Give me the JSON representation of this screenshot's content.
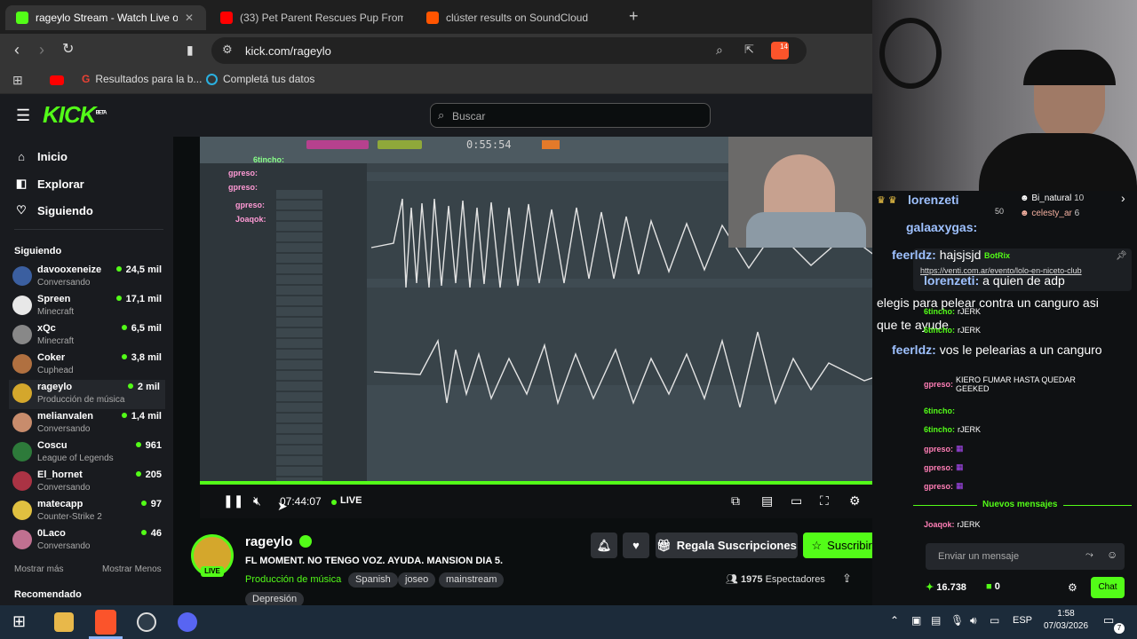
{
  "tabs": [
    {
      "title": "rageylo Stream - Watch Live on Kick",
      "active": true,
      "color": "#53fc18"
    },
    {
      "title": "(33) Pet Parent Rescues Pup From Ka",
      "active": false,
      "color": "#ff0000"
    },
    {
      "title": "clúster results on SoundCloud",
      "active": false,
      "color": "#ff5500"
    }
  ],
  "new_tab_label": "+",
  "address": {
    "url": "kick.com/rageylo",
    "shield_count": "14"
  },
  "bookmarks": [
    {
      "label": "Resultados para la b..."
    },
    {
      "label": "Completá tus datos"
    }
  ],
  "kick": {
    "logo": "KICK",
    "logo_badge": "BETA",
    "search_placeholder": "Buscar",
    "nav": [
      {
        "label": "Inicio",
        "icon": "home-icon"
      },
      {
        "label": "Explorar",
        "icon": "compass-icon"
      },
      {
        "label": "Siguiendo",
        "icon": "heart-icon"
      }
    ],
    "following_title": "Siguiendo",
    "following": [
      {
        "name": "davooxeneize",
        "category": "Conversando",
        "viewers": "24,5 mil",
        "color": "#3b5fa0"
      },
      {
        "name": "Spreen",
        "category": "Minecraft",
        "viewers": "17,1 mil",
        "color": "#e8e8e8"
      },
      {
        "name": "xQc",
        "category": "Minecraft",
        "viewers": "6,5 mil",
        "color": "#888888"
      },
      {
        "name": "Coker",
        "category": "Cuphead",
        "viewers": "3,8 mil",
        "color": "#b07040"
      },
      {
        "name": "rageylo",
        "category": "Producción de música",
        "viewers": "2 mil",
        "color": "#d4a72c"
      },
      {
        "name": "melianvalen",
        "category": "Conversando",
        "viewers": "1,4 mil",
        "color": "#c88c6c"
      },
      {
        "name": "Coscu",
        "category": "League of Legends",
        "viewers": "961",
        "color": "#2d7a3a"
      },
      {
        "name": "El_hornet",
        "category": "Conversando",
        "viewers": "205",
        "color": "#aa3344"
      },
      {
        "name": "matecapp",
        "category": "Counter-Strike 2",
        "viewers": "97",
        "color": "#e0c040"
      },
      {
        "name": "0Laco",
        "category": "Conversando",
        "viewers": "46",
        "color": "#c07090"
      }
    ],
    "show_more": "Mostrar más",
    "show_less": "Mostrar Menos",
    "recommended_title": "Recomendado"
  },
  "player": {
    "daw_time": "0:55:54",
    "elapsed": "07:44:07",
    "live_label": "LIVE",
    "overlay_names": [
      "gpreso:",
      "gpreso:",
      "gpreso:",
      "Joaqok:"
    ],
    "overlay_user": "6tincho:"
  },
  "stream": {
    "channel": "rageylo",
    "title": "FL MOMENT. NO TENGO VOZ. AYUDA. MANSION DIA 5.",
    "category": "Producción de música",
    "tags": [
      "Spanish",
      "joseo",
      "mainstream",
      "Depresión"
    ],
    "live_badge": "LIVE",
    "gift_label": "Regala Suscripciones",
    "subscribe_label": "Suscribirse",
    "viewers": "1975",
    "viewers_label": "Espectadores"
  },
  "chat": {
    "top_user_1": {
      "name": "Bi_natural",
      "count": "10"
    },
    "top_user_2": {
      "name": "celesty_ar",
      "count": "6"
    },
    "top_user_3_count": "50",
    "pinned_user": "BotRix",
    "pinned_link": "https://venti.com.ar/evento/lolo-en-niceto-club",
    "big_lines": [
      {
        "user": "lorenzeti",
        "text": ""
      },
      {
        "user": "galaaxygas:",
        "text": ""
      },
      {
        "user": "feerldz:",
        "text": "hajsjsjd"
      },
      {
        "user": "lorenzeti:",
        "text": "a quien de adp"
      },
      {
        "user": "",
        "text": "elegis para pelear contra un canguro asi"
      },
      {
        "user": "",
        "text": "que te ayude"
      },
      {
        "user": "feerldz:",
        "text": "vos le pelearias a un canguro"
      }
    ],
    "messages": [
      {
        "user": "6tincho:",
        "text": "rJERK",
        "color": "#53fc18"
      },
      {
        "user": "6tincho:",
        "text": "rJERK",
        "color": "#53fc18"
      },
      {
        "user": "gpreso:",
        "text": "KIERO FUMAR HASTA QUEDAR GEEKED",
        "color": "#ff7eb6"
      },
      {
        "user": "gpreso:",
        "text": "KIERO FUMAR HASTA QUEDAR GEEKED",
        "color": "#ff7eb6"
      },
      {
        "user": "6tincho:",
        "text": "",
        "color": "#53fc18"
      },
      {
        "user": "6tincho:",
        "text": "rJERK",
        "color": "#53fc18"
      },
      {
        "user": "gpreso:",
        "text": "",
        "color": "#ff7eb6"
      },
      {
        "user": "gpreso:",
        "text": "",
        "color": "#ff7eb6"
      },
      {
        "user": "gpreso:",
        "text": "",
        "color": "#ff7eb6"
      }
    ],
    "new_messages": "Nuevos mensajes",
    "last_message": {
      "user": "Joaqok:",
      "text": "rJERK"
    },
    "input_placeholder": "Enviar un mensaje",
    "points": "16.738",
    "zero": "0",
    "chat_button": "Chat"
  },
  "taskbar": {
    "lang": "ESP",
    "time": "1:58",
    "date": "07/03/2026",
    "notif_count": "7"
  }
}
